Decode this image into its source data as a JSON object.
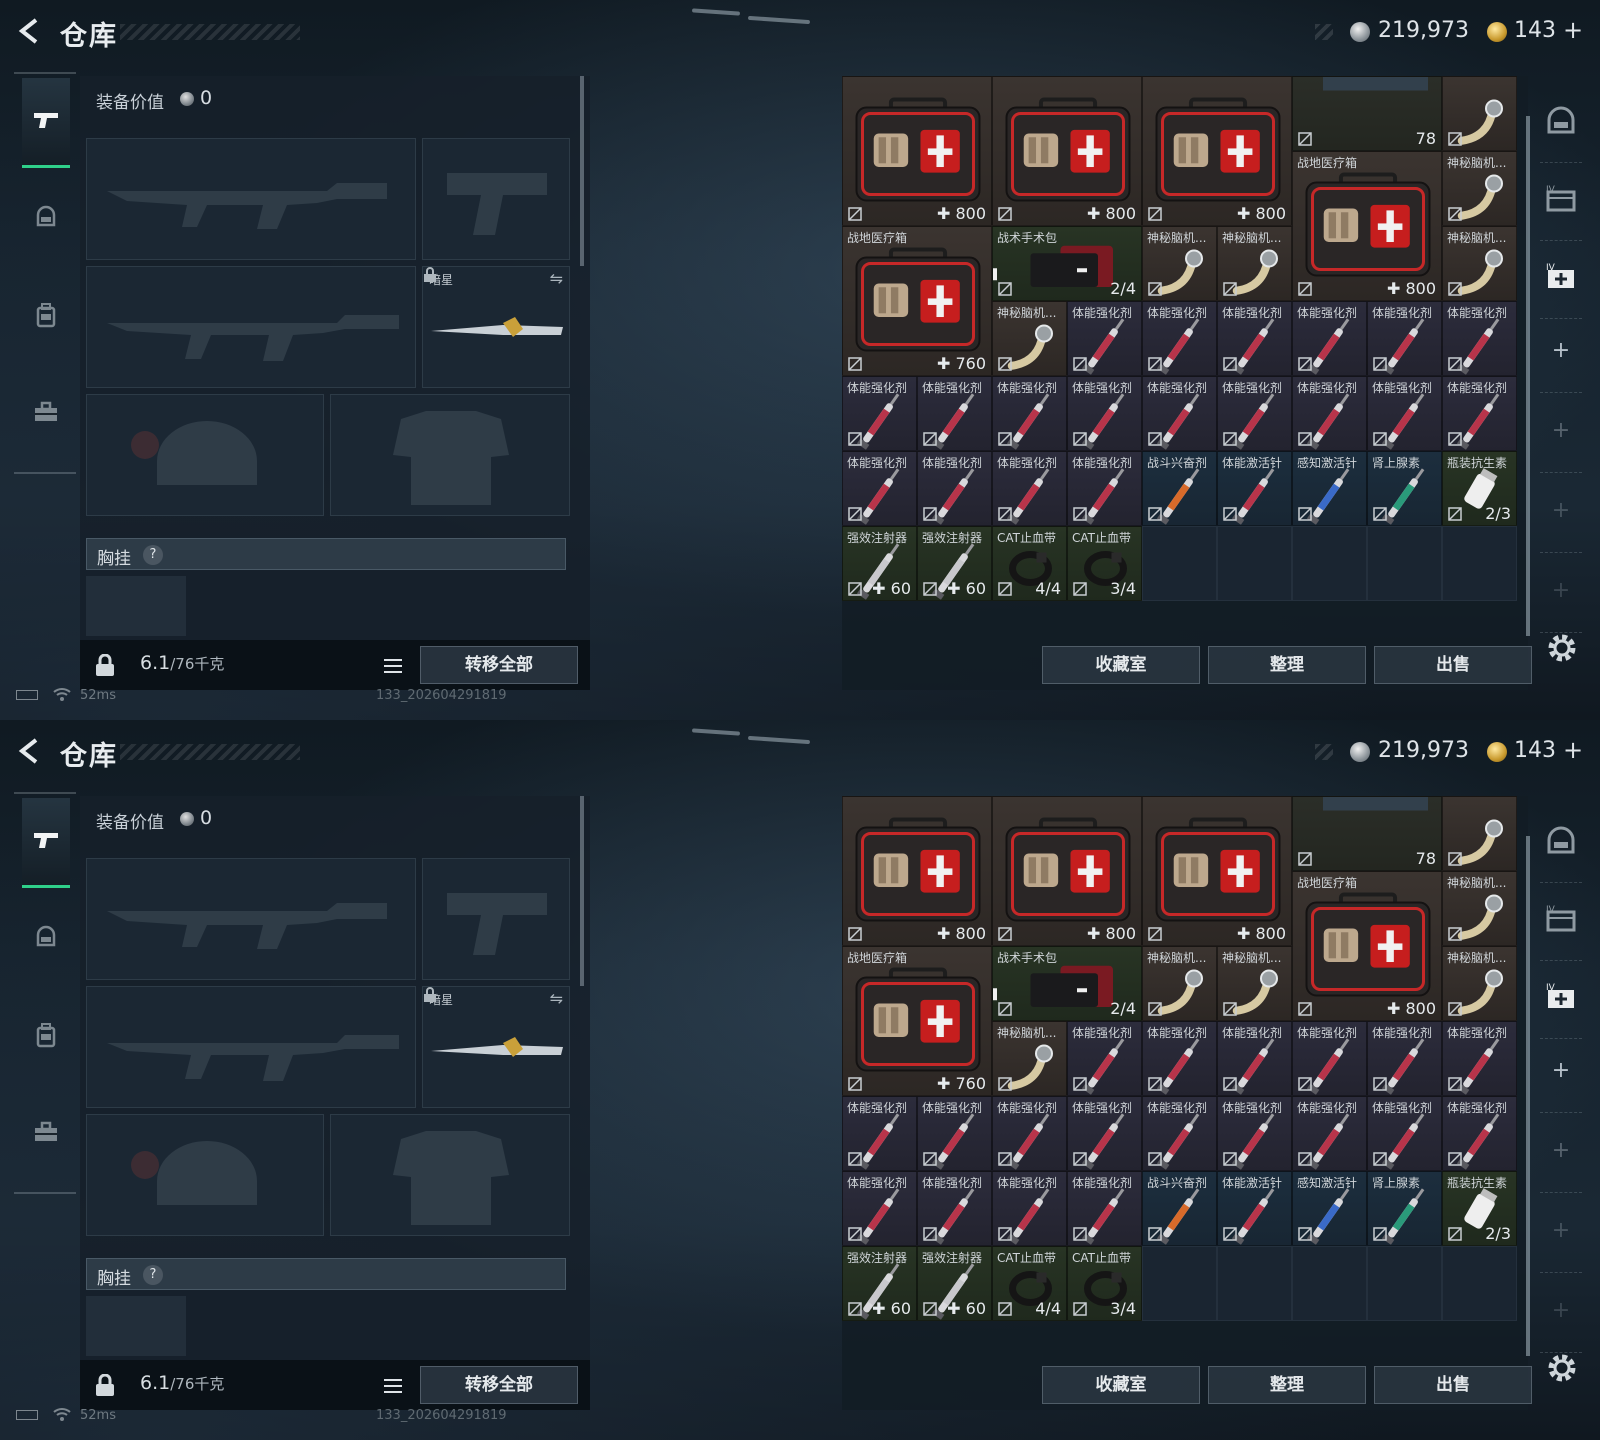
{
  "header": {
    "title": "仓库",
    "currency_silver": "219,973",
    "currency_gold": "143",
    "gold_plus": "+"
  },
  "left_nav": {
    "items": [
      "weapon-pistol-icon",
      "helmet-icon",
      "backpack-icon",
      "toolbox-icon"
    ]
  },
  "equipment": {
    "value_label": "装备价值",
    "value": "0",
    "melee_slot_label": "暗星",
    "vest_label": "胸挂",
    "vest_help": "?",
    "weight": "6.1",
    "weight_max": "/76千克",
    "transfer_all": "转移全部"
  },
  "status_bar": {
    "ping": "52ms",
    "build": "133_202604291819"
  },
  "stash": {
    "items": [
      {
        "name": "",
        "value": "✚ 800",
        "icon": "medkit",
        "color": "brown"
      },
      {
        "name": "",
        "value": "✚ 800",
        "icon": "medkit",
        "color": "brown"
      },
      {
        "name": "",
        "value": "✚ 800",
        "icon": "medkit",
        "color": "brown"
      },
      {
        "name": "",
        "value": "78",
        "icon": "armor-partial",
        "color": "olive"
      },
      {
        "name": "",
        "value": "",
        "icon": "horn",
        "color": "brown"
      },
      {
        "name": "战地医疗箱",
        "value": "✚ 800",
        "icon": "medkit",
        "color": "brown"
      },
      {
        "name": "神秘脑机...",
        "value": "",
        "icon": "horn",
        "color": "brown"
      },
      {
        "name": "战地医疗箱",
        "value": "✚ 760",
        "icon": "medkit",
        "color": "brown"
      },
      {
        "name": "战术手术包",
        "value": "2/4",
        "icon": "surgery-kit",
        "color": "green"
      },
      {
        "name": "神秘脑机...",
        "value": "",
        "icon": "horn",
        "color": "brown"
      },
      {
        "name": "神秘脑机...",
        "value": "",
        "icon": "horn",
        "color": "brown"
      },
      {
        "name": "神秘脑机...",
        "value": "",
        "icon": "horn",
        "color": "brown"
      },
      {
        "name": "神秘脑机...",
        "value": "",
        "icon": "horn",
        "color": "brown"
      },
      {
        "name": "体能强化剂",
        "value": "",
        "icon": "syringe-red",
        "color": "purple"
      },
      {
        "name": "体能强化剂",
        "value": "",
        "icon": "syringe-red",
        "color": "purple"
      },
      {
        "name": "体能强化剂",
        "value": "",
        "icon": "syringe-red",
        "color": "purple"
      },
      {
        "name": "体能强化剂",
        "value": "",
        "icon": "syringe-red",
        "color": "purple"
      },
      {
        "name": "体能强化剂",
        "value": "",
        "icon": "syringe-red",
        "color": "purple"
      },
      {
        "name": "体能强化剂",
        "value": "",
        "icon": "syringe-red",
        "color": "purple"
      },
      {
        "name": "体能强化剂",
        "value": "",
        "icon": "syringe-red",
        "color": "purple"
      },
      {
        "name": "体能强化剂",
        "value": "",
        "icon": "syringe-red",
        "color": "purple"
      },
      {
        "name": "体能强化剂",
        "value": "",
        "icon": "syringe-red",
        "color": "purple"
      },
      {
        "name": "体能强化剂",
        "value": "",
        "icon": "syringe-red",
        "color": "purple"
      },
      {
        "name": "体能强化剂",
        "value": "",
        "icon": "syringe-red",
        "color": "purple"
      },
      {
        "name": "体能强化剂",
        "value": "",
        "icon": "syringe-red",
        "color": "purple"
      },
      {
        "name": "体能强化剂",
        "value": "",
        "icon": "syringe-red",
        "color": "purple"
      },
      {
        "name": "体能强化剂",
        "value": "",
        "icon": "syringe-red",
        "color": "purple"
      },
      {
        "name": "体能强化剂",
        "value": "",
        "icon": "syringe-red",
        "color": "purple"
      },
      {
        "name": "体能强化剂",
        "value": "",
        "icon": "syringe-red",
        "color": "purple"
      },
      {
        "name": "体能强化剂",
        "value": "",
        "icon": "syringe-red",
        "color": "purple"
      },
      {
        "name": "体能强化剂",
        "value": "",
        "icon": "syringe-red",
        "color": "purple"
      },
      {
        "name": "体能强化剂",
        "value": "",
        "icon": "syringe-red",
        "color": "purple"
      },
      {
        "name": "战斗兴奋剂",
        "value": "",
        "icon": "syringe-orange",
        "color": "blue"
      },
      {
        "name": "体能激活针",
        "value": "",
        "icon": "syringe-red",
        "color": "blue"
      },
      {
        "name": "感知激活针",
        "value": "",
        "icon": "syringe-blue",
        "color": "blue"
      },
      {
        "name": "肾上腺素",
        "value": "",
        "icon": "syringe-teal",
        "color": "blue"
      },
      {
        "name": "瓶装抗生素",
        "value": "2/3",
        "icon": "bottle",
        "color": "green"
      },
      {
        "name": "强效注射器",
        "value": "✚ 60",
        "icon": "syringe-clear",
        "color": "green"
      },
      {
        "name": "强效注射器",
        "value": "✚ 60",
        "icon": "syringe-clear",
        "color": "green"
      },
      {
        "name": "CAT止血带",
        "value": "4/4",
        "icon": "tourniquet",
        "color": "green"
      },
      {
        "name": "CAT止血带",
        "value": "3/4",
        "icon": "tourniquet",
        "color": "green"
      }
    ],
    "buttons": [
      "收藏室",
      "整理",
      "出售"
    ]
  },
  "side_bar": {
    "tabs": [
      "helmet-tab-icon",
      "case-tab-icon",
      "medkit-tab-icon"
    ],
    "plus": "+"
  },
  "colors": {
    "accent_green": "#2fd08a",
    "item_brown": "#3b3430",
    "item_purple": "#2c2c3c",
    "item_blue": "#1c2e3e",
    "item_green": "#283424"
  }
}
